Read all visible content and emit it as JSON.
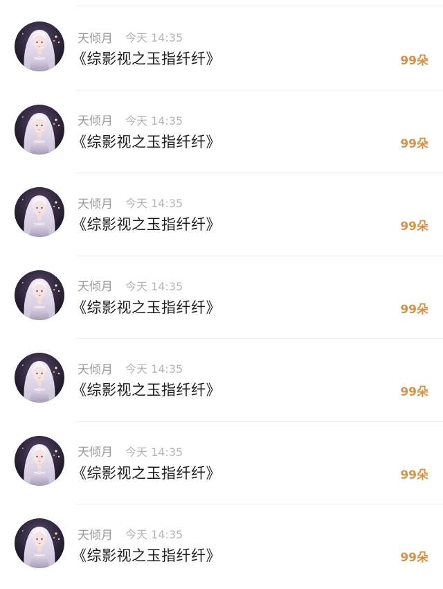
{
  "records": [
    {
      "username": "天倾月",
      "time": "今天 14:35",
      "title": "《综影视之玉指纤纤》",
      "amount": "99朵",
      "avatar_icon": "avatar-icon"
    },
    {
      "username": "天倾月",
      "time": "今天 14:35",
      "title": "《综影视之玉指纤纤》",
      "amount": "99朵",
      "avatar_icon": "avatar-icon"
    },
    {
      "username": "天倾月",
      "time": "今天 14:35",
      "title": "《综影视之玉指纤纤》",
      "amount": "99朵",
      "avatar_icon": "avatar-icon"
    },
    {
      "username": "天倾月",
      "time": "今天 14:35",
      "title": "《综影视之玉指纤纤》",
      "amount": "99朵",
      "avatar_icon": "avatar-icon"
    },
    {
      "username": "天倾月",
      "time": "今天 14:35",
      "title": "《综影视之玉指纤纤》",
      "amount": "99朵",
      "avatar_icon": "avatar-icon"
    },
    {
      "username": "天倾月",
      "time": "今天 14:35",
      "title": "《综影视之玉指纤纤》",
      "amount": "99朵",
      "avatar_icon": "avatar-icon"
    },
    {
      "username": "天倾月",
      "time": "今天 14:35",
      "title": "《综影视之玉指纤纤》",
      "amount": "99朵",
      "avatar_icon": "avatar-icon"
    }
  ],
  "colors": {
    "accent": "#d89146",
    "username": "#9a9a9a",
    "time": "#b4b4b4",
    "title": "#1c1c1c"
  }
}
